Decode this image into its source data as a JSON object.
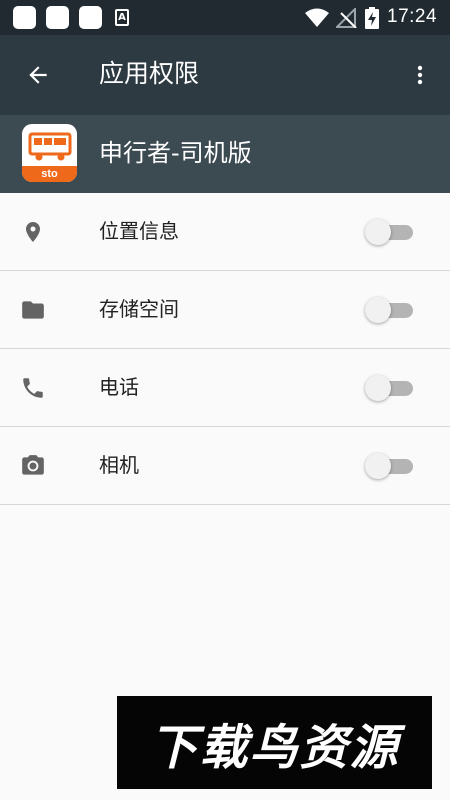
{
  "status_bar": {
    "time": "17:24",
    "notification_icons": [
      "notification-icon",
      "notification-icon",
      "notification-icon",
      "a-notification-icon"
    ],
    "notif_a_letter": "A",
    "system_icons": [
      "wifi-icon",
      "no-signal-icon",
      "battery-charging-icon"
    ]
  },
  "toolbar": {
    "title": "应用权限",
    "back_icon": "arrow-back-icon",
    "more_icon": "more-vert-icon"
  },
  "app": {
    "name": "申行者-司机版",
    "icon_label": "sto",
    "icon_color": "#ee6a1a"
  },
  "permissions": [
    {
      "label": "位置信息",
      "icon": "location-pin-icon",
      "enabled": false
    },
    {
      "label": "存储空间",
      "icon": "folder-icon",
      "enabled": false
    },
    {
      "label": "电话",
      "icon": "phone-icon",
      "enabled": false
    },
    {
      "label": "相机",
      "icon": "camera-icon",
      "enabled": false
    }
  ],
  "watermark": {
    "text": "下载鸟资源"
  },
  "colors": {
    "status_bar": "#202a30",
    "toolbar": "#2d3a42",
    "app_header": "#3c4a52",
    "background": "#fafafa",
    "icon_gray": "#646464",
    "toggle_off_track": "#b4b4b4",
    "toggle_off_thumb": "#f1f1f1"
  }
}
